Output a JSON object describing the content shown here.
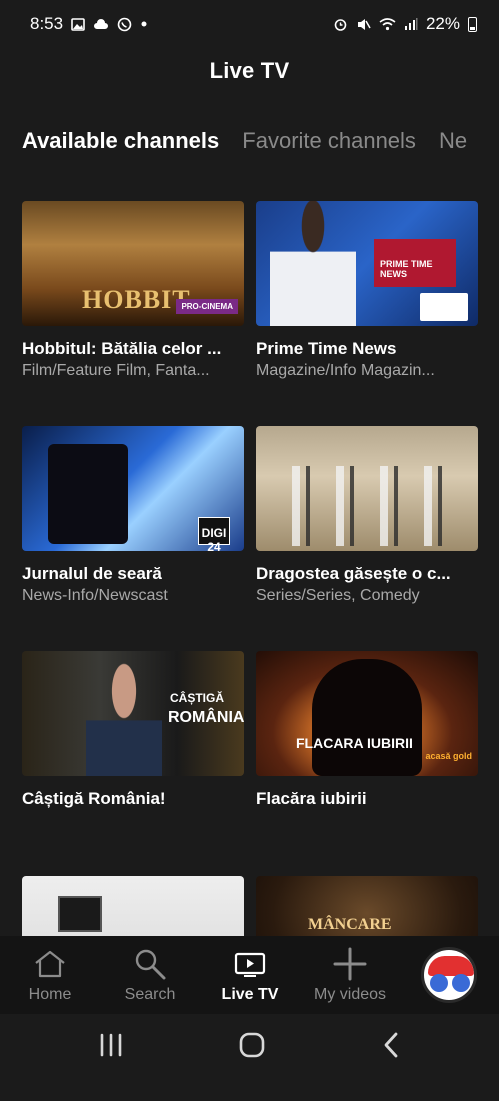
{
  "status_bar": {
    "time": "8:53",
    "battery": "22%",
    "icons_left": [
      "gallery-icon",
      "cloud-icon",
      "whatsapp-icon",
      "dot-icon"
    ],
    "icons_right": [
      "alarm-icon",
      "mute-icon",
      "wifi-icon",
      "signal-icon",
      "battery-icon"
    ]
  },
  "header": {
    "title": "Live TV"
  },
  "tabs": [
    {
      "label": "Available channels",
      "active": true
    },
    {
      "label": "Favorite channels",
      "active": false
    },
    {
      "label": "Ne",
      "active": false
    }
  ],
  "channels": [
    {
      "title": "Hobbitul: Bătălia celor ...",
      "subtitle": "Film/Feature Film, Fanta...",
      "thumb_text": "HOBBIT",
      "badge": "PRO-CINEMA"
    },
    {
      "title": "Prime Time News",
      "subtitle": "Magazine/Info Magazin...",
      "thumb_text": "PRIME TIME NEWS"
    },
    {
      "title": "Jurnalul de seară",
      "subtitle": "News-Info/Newscast",
      "thumb_text": "DIGI 24"
    },
    {
      "title": "Dragostea găsește o c...",
      "subtitle": "Series/Series, Comedy"
    },
    {
      "title": "Câștigă România!",
      "subtitle": "",
      "thumb_text": "CÂȘTIGĂ",
      "thumb_text2": "ROMÂNIA!"
    },
    {
      "title": "Flacăra iubirii",
      "subtitle": "",
      "thumb_text": "FLACARA IUBIRII",
      "badge": "acasă gold"
    },
    {
      "title": "",
      "subtitle": ""
    },
    {
      "title": "",
      "subtitle": "",
      "thumb_text": "MÂNCARE"
    }
  ],
  "bottom_nav": [
    {
      "label": "Home",
      "icon": "home-icon",
      "active": false
    },
    {
      "label": "Search",
      "icon": "search-icon",
      "active": false
    },
    {
      "label": "Live TV",
      "icon": "live-tv-icon",
      "active": true
    },
    {
      "label": "My videos",
      "icon": "plus-icon",
      "active": false
    }
  ],
  "colors": {
    "background": "#1b1b1b",
    "nav_background": "#141414",
    "inactive_text": "#8a8a8a"
  }
}
